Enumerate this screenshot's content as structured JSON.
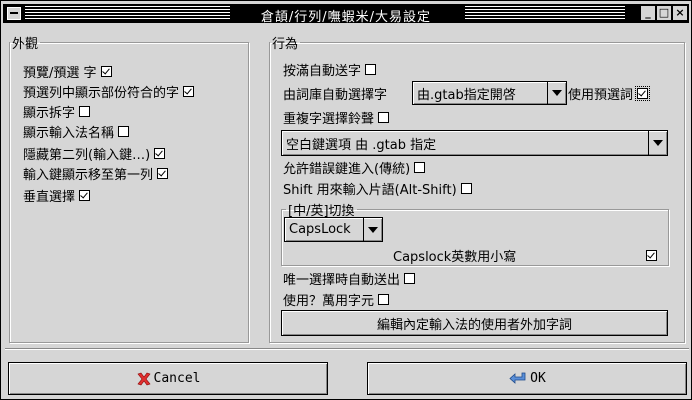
{
  "window": {
    "title": "倉頡/行列/嘸蝦米/大易設定"
  },
  "appearance": {
    "legend": "外觀",
    "items": [
      {
        "label": "預覽/預選 字",
        "checked": true
      },
      {
        "label": "預選列中顯示部份符合的字",
        "checked": true
      },
      {
        "label": "顯示拆字",
        "checked": false
      },
      {
        "label": "顯示輸入法名稱",
        "checked": false
      },
      {
        "label": "隱藏第二列(輸入鍵…)",
        "checked": true
      },
      {
        "label": "輸入鍵顯示移至第一列",
        "checked": true
      },
      {
        "label": "垂直選擇",
        "checked": true
      }
    ]
  },
  "behavior": {
    "legend": "行為",
    "auto_send_full": {
      "label": "按滿自動送字",
      "checked": false
    },
    "auto_select_label": "由詞庫自動選擇字",
    "auto_select_combo": "由.gtab指定開啓",
    "use_preselect": {
      "label": "使用預選詞",
      "checked": true
    },
    "repeat_select": {
      "label": "重複字選擇鈴聲",
      "checked": false
    },
    "space_combo": "空白鍵選項 由 .gtab 指定",
    "allow_wrong": {
      "label": "允許錯誤鍵進入(傳統)",
      "checked": false
    },
    "shift_phrase": {
      "label": "Shift 用來輸入片語(Alt-Shift)",
      "checked": false
    },
    "switch": {
      "legend": "[中/英]切換",
      "combo": "CapsLock",
      "caps_lower": {
        "label": "Capslock英數用小寫",
        "checked": true
      }
    },
    "single_auto": {
      "label": "唯一選擇時自動送出",
      "checked": false
    },
    "wildcard": {
      "label": "使用？萬用字元",
      "checked": false
    },
    "edit_button": "編輯內定輸入法的使用者外加字詞"
  },
  "footer": {
    "cancel": "Cancel",
    "ok": "OK"
  }
}
